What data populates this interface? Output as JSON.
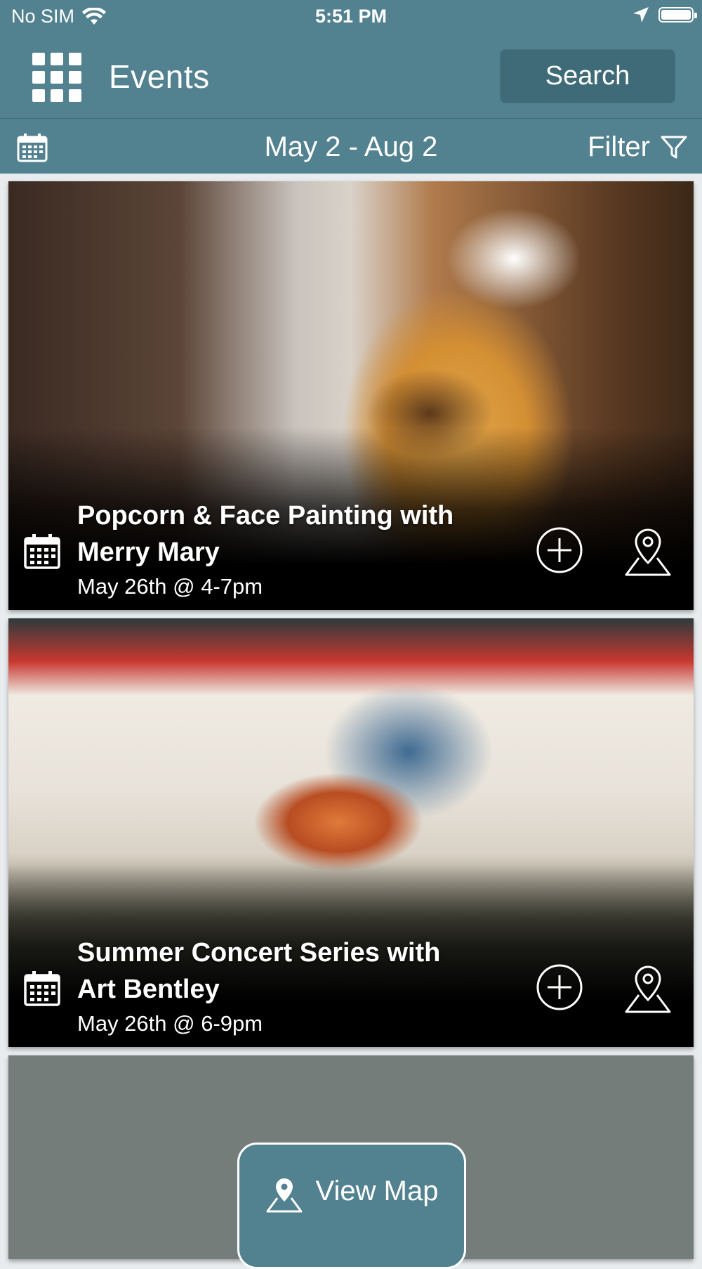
{
  "status_bar": {
    "carrier": "No SIM",
    "time": "5:51 PM"
  },
  "header": {
    "title": "Events",
    "search_label": "Search",
    "menu_icon": "grid-menu-icon"
  },
  "date_bar": {
    "range": "May 2  -  Aug 2",
    "filter_label": "Filter"
  },
  "events": [
    {
      "title": "Popcorn & Face Painting with Merry Mary",
      "date": "May 26th @ 4-7pm",
      "image": "child face painting photo"
    },
    {
      "title": "Summer Concert Series with Art Bentley",
      "date": "May 26th @ 6-9pm",
      "image": "guitarist performing photo"
    }
  ],
  "map_panel": {
    "button_label": "View Map"
  },
  "colors": {
    "primary": "#52818f",
    "primary_dark": "#3f6b78",
    "map_background": "#757d7a"
  }
}
